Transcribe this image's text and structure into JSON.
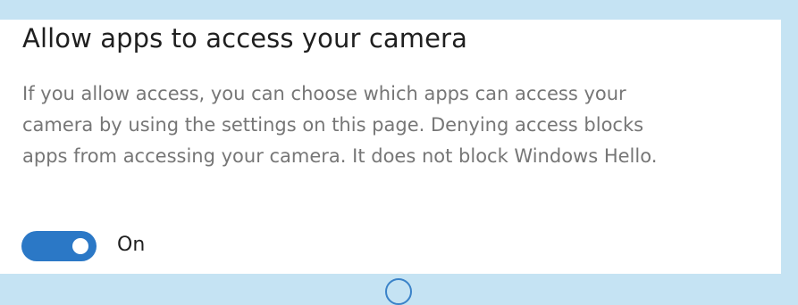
{
  "section": {
    "title": "Allow apps to access your camera",
    "description_lines": [
      "If you allow access, you can choose which apps can access your",
      "camera by using the settings on this page. Denying access blocks",
      "apps from accessing your camera. It does not block Windows Hello."
    ]
  },
  "toggle": {
    "state": "on",
    "label": "On",
    "accent_color": "#2b78c6"
  },
  "colors": {
    "background": "#c5e3f3",
    "panel": "#ffffff",
    "title_text": "#1f1f1f",
    "description_text": "#767676"
  },
  "icons": {
    "bottom": "circle-icon"
  }
}
